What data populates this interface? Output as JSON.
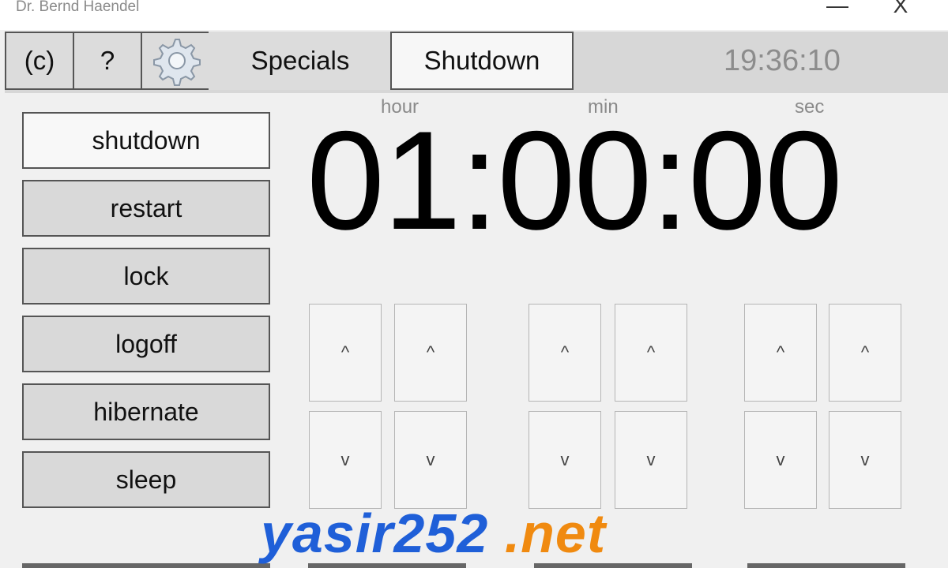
{
  "window": {
    "title": "Dr. Bernd Haendel",
    "minimize_glyph": "—",
    "close_glyph": "X"
  },
  "tabs": [
    {
      "label": "(c)"
    },
    {
      "label": "?"
    },
    {
      "label": "",
      "icon": "gear-icon"
    },
    {
      "label": "Specials"
    },
    {
      "label": "Shutdown",
      "active": true
    }
  ],
  "clock": "19:36:10",
  "actions": [
    {
      "label": "shutdown",
      "selected": true
    },
    {
      "label": "restart"
    },
    {
      "label": "lock"
    },
    {
      "label": "logoff"
    },
    {
      "label": "hibernate"
    },
    {
      "label": "sleep"
    }
  ],
  "timer": {
    "labels": {
      "hour": "hour",
      "min": "min",
      "sec": "sec"
    },
    "display": "01:00:00"
  },
  "spinners": {
    "up": "^",
    "down": "v"
  },
  "watermark": {
    "main": "yasir252",
    "tld": " .net"
  },
  "colors": {
    "watermark_blue": "#1f5fd8",
    "watermark_orange": "#f08a10",
    "clock_gray": "#8c8c8c"
  }
}
